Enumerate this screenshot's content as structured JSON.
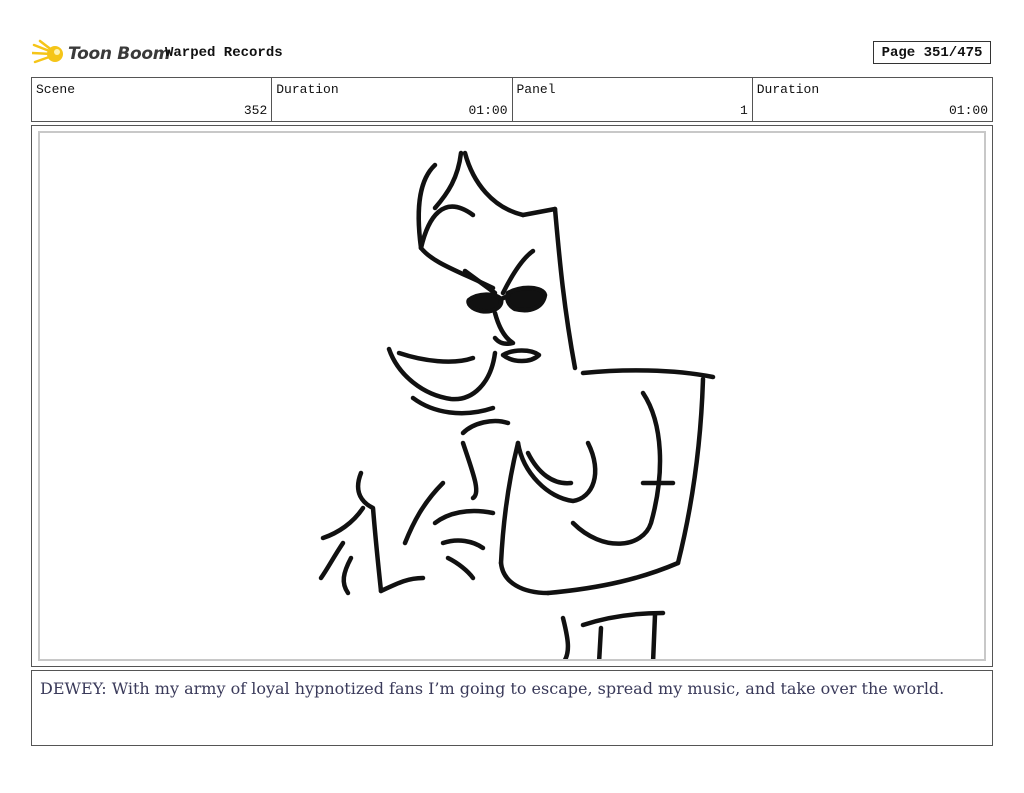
{
  "header": {
    "logo_text": "Toon Boom",
    "project_title": "Warped Records",
    "page_label": "Page 351/475"
  },
  "info": {
    "scene_label": "Scene",
    "scene_value": "352",
    "duration_label": "Duration",
    "duration_value": "01:00",
    "panel_label": "Panel",
    "panel_value": "1",
    "panel_duration_label": "Duration",
    "panel_duration_value": "01:00"
  },
  "panel": {
    "image_subject": "rough storyboard sketch of a character wearing sunglasses gesturing with both hands"
  },
  "dialogue": {
    "text": "DEWEY: With my army of loyal hypnotized fans I’m going to escape, spread my music, and take over the world."
  },
  "colors": {
    "logo_accent": "#f5c518",
    "dialogue_text": "#3a3a5a",
    "border": "#555555"
  }
}
